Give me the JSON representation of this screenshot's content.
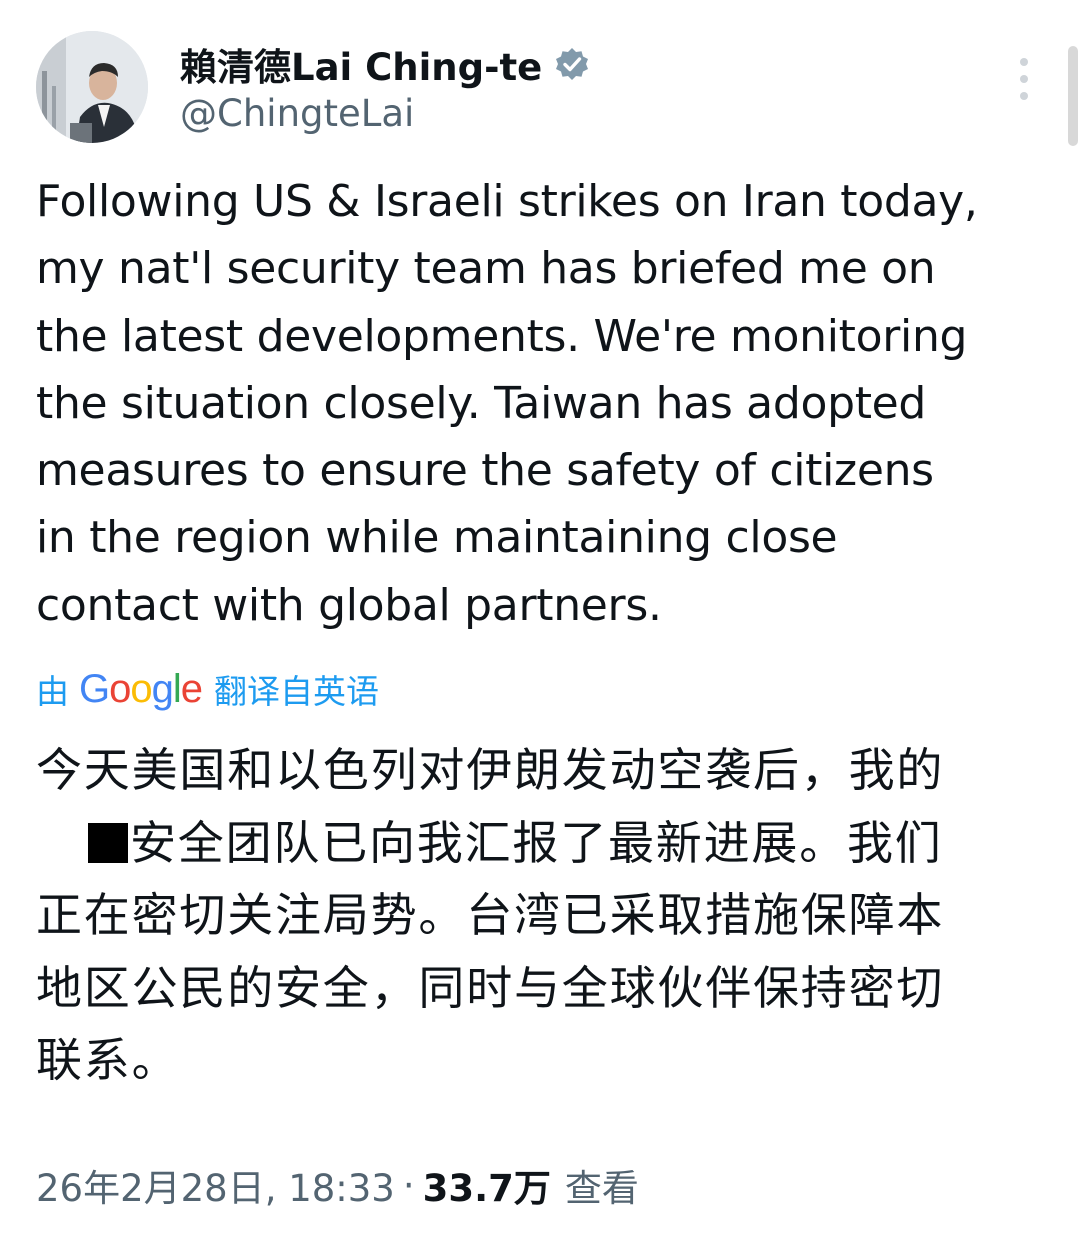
{
  "author": {
    "display_name": "賴清德Lai Ching-te",
    "handle": "@ChingteLai",
    "verified": true,
    "avatar_icon": "profile-photo"
  },
  "tweet": {
    "text_lines": [
      "Following US & Israeli strikes on Iran today,",
      "my nat'l security team has briefed me on",
      "the latest developments. We're monitoring",
      "the situation closely. Taiwan has adopted",
      "measures to ensure the safety of citizens",
      "in the region while maintaining close",
      "contact with global partners."
    ]
  },
  "translation": {
    "prefix": "由",
    "provider": "Google",
    "suffix": "翻译自英语",
    "line1": "今天美国和以色列对伊朗发动空袭后，我的",
    "line2": "安全团队已向我汇报了最新进展。我们",
    "line3": "正在密切关注局势。台湾已采取措施保障本",
    "line4": "地区公民的安全，同时与全球伙伴保持密切",
    "line5": "联系。"
  },
  "meta": {
    "timestamp": "26年2月28日, 18:33",
    "separator": "·",
    "views_count": "33.7万",
    "views_label": "查看"
  },
  "colors": {
    "link_blue": "#1d9bf0",
    "secondary_text": "#536471",
    "primary_text": "#0f1419"
  }
}
